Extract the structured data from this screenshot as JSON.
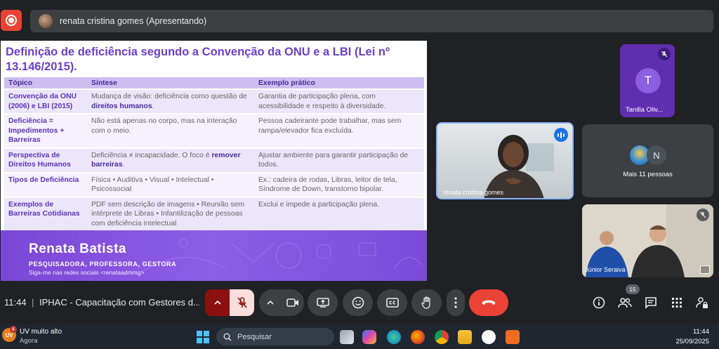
{
  "presenting_bar": {
    "text": "renata cristina gomes (Apresentando)"
  },
  "slide": {
    "title": "Definição de deficiência segundo a Convenção da ONU e a LBI (Lei nº 13.146/2015).",
    "columns": [
      "Tópico",
      "Síntese",
      "Exemplo prático"
    ],
    "rows": [
      {
        "topic": "Convenção da ONU (2006) e LBI (2015)",
        "syn_pre": "Mudança de visão: deficiência como questão de ",
        "syn_bold": "direitos humanos",
        "syn_post": ".",
        "example": "Garantia de participação plena, com acessibilidade e respeito à diversidade."
      },
      {
        "topic": "Deficiência = Impedimentos + Barreiras",
        "syn_pre": "Não está apenas no corpo, mas na interação com o meio.",
        "syn_bold": "",
        "syn_post": "",
        "example": "Pessoa cadeirante pode trabalhar, mas sem rampa/elevador fica excluída."
      },
      {
        "topic": "Perspectiva de Direitos Humanos",
        "syn_pre": "Deficiência ≠ incapacidade. O foco é ",
        "syn_bold": "remover barreiras",
        "syn_post": ".",
        "example": "Ajustar ambiente para garantir participação de todos."
      },
      {
        "topic": "Tipos de Deficiência",
        "syn_pre": "Física • Auditiva • Visual • Intelectual • Psicossocial",
        "syn_bold": "",
        "syn_post": "",
        "example": "Ex.: cadeira de rodas, Libras, leitor de tela, Síndrome de Down, transtorno bipolar."
      },
      {
        "topic": "Exemplos de Barreiras Cotidianas",
        "syn_pre": "PDF sem descrição de imagens • Reunião sem intérprete de Libras • Infantilização de pessoas com deficiência intelectual",
        "syn_bold": "",
        "syn_post": "",
        "example": "Exclui e impede a participação plena."
      }
    ],
    "footer": {
      "name": "Renata Batista",
      "role": "PESQUISADORA, PROFESSORA, GESTORA",
      "social": "Siga-me nas redes sociais <renataadmmg>"
    }
  },
  "participants": {
    "tanilla": {
      "initial": "T",
      "name": "Tanilla Oliv..."
    },
    "renata": {
      "name": "renata cristina gomes"
    },
    "more": {
      "initial": "N",
      "label": "Mais 11 pessoas"
    },
    "junior": {
      "name": "Júnior Seraiva"
    }
  },
  "controls": {
    "time": "11:44",
    "separator": "|",
    "meeting_name": "IPHAC - Capacitação com Gestores d...",
    "people_count": "15"
  },
  "taskbar": {
    "weather_badge": "4",
    "weather_icon_text": "UV",
    "weather_title": "UV muito alto",
    "weather_sub": "Agora",
    "search_placeholder": "Pesquisar",
    "time": "11:44",
    "date": "25/09/2025"
  },
  "colors": {
    "accent_purple": "#6b3fc9",
    "leave_red": "#ea4335",
    "mic_off_red": "#a50e0e",
    "speaking_blue": "#1a73e8"
  }
}
